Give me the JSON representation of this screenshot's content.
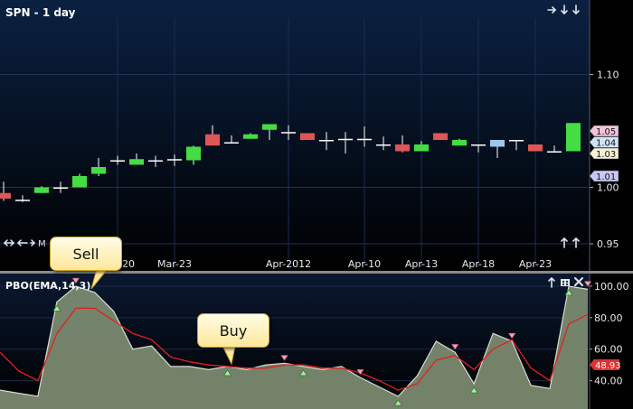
{
  "top_panel": {
    "title": "SPN - 1 day",
    "toolbar_label": "M",
    "nav_icons": [
      "arrow-right-icon",
      "arrow-down-icon",
      "arrow-down-icon"
    ],
    "price_markers": [
      {
        "label": "1.05",
        "value": 1.05,
        "color": "#f2c4dc"
      },
      {
        "label": "1.04",
        "value": 1.04,
        "color": "#cfe3f5"
      },
      {
        "label": "1.03",
        "value": 1.03,
        "color": "#f7f0d8"
      },
      {
        "label": "1.01",
        "value": 1.01,
        "color": "#c8c8f4"
      }
    ]
  },
  "bottom_panel": {
    "title": "PBO(EMA,14,3)",
    "current_value_label": "48.93",
    "current_value": 48.93
  },
  "callouts": {
    "sell": "Sell",
    "buy": "Buy"
  },
  "colors": {
    "up": "#44dd44",
    "down": "#e05555",
    "neutral": "#ffffff",
    "highlight": "#9cc8f0",
    "area": "#7e8d72",
    "signal": "#e02020",
    "background_top": "#0b2142",
    "background_bottom": "#000000"
  },
  "chart_data": [
    {
      "type": "candlestick",
      "title": "SPN - 1 day",
      "y_ticks": [
        0.95,
        1.0,
        1.1
      ],
      "ylim": [
        0.93,
        1.15
      ],
      "x_tick_labels": [
        {
          "label": "Mar-20",
          "index": 6
        },
        {
          "label": "Mar-23",
          "index": 9
        },
        {
          "label": "Apr-2012",
          "index": 15
        },
        {
          "label": "Apr-10",
          "index": 19
        },
        {
          "label": "Apr-13",
          "index": 22
        },
        {
          "label": "Apr-18",
          "index": 25
        },
        {
          "label": "Apr-23",
          "index": 28
        }
      ],
      "candles": [
        {
          "o": 0.995,
          "h": 1.005,
          "l": 0.988,
          "c": 0.99,
          "color": "down"
        },
        {
          "o": 0.989,
          "h": 0.993,
          "l": 0.987,
          "c": 0.989,
          "color": "neutral"
        },
        {
          "o": 0.995,
          "h": 1.001,
          "l": 0.995,
          "c": 1.0,
          "color": "up"
        },
        {
          "o": 1.0,
          "h": 1.005,
          "l": 0.995,
          "c": 1.0,
          "color": "neutral"
        },
        {
          "o": 1.0,
          "h": 1.012,
          "l": 1.0,
          "c": 1.01,
          "color": "up"
        },
        {
          "o": 1.012,
          "h": 1.026,
          "l": 1.01,
          "c": 1.018,
          "color": "up"
        },
        {
          "o": 1.024,
          "h": 1.028,
          "l": 1.02,
          "c": 1.024,
          "color": "neutral"
        },
        {
          "o": 1.02,
          "h": 1.03,
          "l": 1.02,
          "c": 1.025,
          "color": "up"
        },
        {
          "o": 1.024,
          "h": 1.028,
          "l": 1.018,
          "c": 1.024,
          "color": "neutral"
        },
        {
          "o": 1.025,
          "h": 1.029,
          "l": 1.019,
          "c": 1.025,
          "color": "neutral"
        },
        {
          "o": 1.024,
          "h": 1.037,
          "l": 1.02,
          "c": 1.036,
          "color": "up"
        },
        {
          "o": 1.047,
          "h": 1.055,
          "l": 1.039,
          "c": 1.037,
          "color": "down"
        },
        {
          "o": 1.04,
          "h": 1.046,
          "l": 1.04,
          "c": 1.04,
          "color": "neutral"
        },
        {
          "o": 1.043,
          "h": 1.048,
          "l": 1.043,
          "c": 1.047,
          "color": "up"
        },
        {
          "o": 1.051,
          "h": 1.056,
          "l": 1.042,
          "c": 1.056,
          "color": "up"
        },
        {
          "o": 1.049,
          "h": 1.055,
          "l": 1.042,
          "c": 1.049,
          "color": "neutral"
        },
        {
          "o": 1.048,
          "h": 1.048,
          "l": 1.042,
          "c": 1.042,
          "color": "down"
        },
        {
          "o": 1.042,
          "h": 1.049,
          "l": 1.033,
          "c": 1.042,
          "color": "neutral"
        },
        {
          "o": 1.043,
          "h": 1.049,
          "l": 1.03,
          "c": 1.043,
          "color": "neutral"
        },
        {
          "o": 1.043,
          "h": 1.054,
          "l": 1.036,
          "c": 1.043,
          "color": "neutral"
        },
        {
          "o": 1.038,
          "h": 1.045,
          "l": 1.033,
          "c": 1.038,
          "color": "neutral"
        },
        {
          "o": 1.038,
          "h": 1.046,
          "l": 1.031,
          "c": 1.032,
          "color": "down"
        },
        {
          "o": 1.032,
          "h": 1.041,
          "l": 1.032,
          "c": 1.038,
          "color": "up"
        },
        {
          "o": 1.048,
          "h": 1.048,
          "l": 1.042,
          "c": 1.042,
          "color": "down"
        },
        {
          "o": 1.037,
          "h": 1.043,
          "l": 1.037,
          "c": 1.042,
          "color": "up"
        },
        {
          "o": 1.038,
          "h": 1.038,
          "l": 1.031,
          "c": 1.038,
          "color": "neutral"
        },
        {
          "o": 1.036,
          "h": 1.042,
          "l": 1.026,
          "c": 1.042,
          "color": "highlight"
        },
        {
          "o": 1.042,
          "h": 1.042,
          "l": 1.033,
          "c": 1.042,
          "color": "neutral"
        },
        {
          "o": 1.038,
          "h": 1.038,
          "l": 1.032,
          "c": 1.032,
          "color": "down"
        },
        {
          "o": 1.032,
          "h": 1.037,
          "l": 1.032,
          "c": 1.032,
          "color": "neutral"
        },
        {
          "o": 1.032,
          "h": 1.057,
          "l": 1.032,
          "c": 1.057,
          "color": "up"
        }
      ]
    },
    {
      "type": "area",
      "title": "PBO(EMA,14,3)",
      "y_ticks": [
        40.0,
        60.0,
        80.0,
        100.0
      ],
      "ylim": [
        22,
        108
      ],
      "series": [
        {
          "values": [
            34,
            32,
            30,
            90,
            100,
            96,
            84,
            60,
            62,
            49,
            49,
            47,
            49,
            47,
            50,
            51,
            49,
            47,
            49,
            42,
            36,
            30,
            43,
            65,
            58,
            38,
            70,
            65,
            37,
            35,
            100,
            98
          ]
        },
        {
          "values": [
            58,
            46,
            40,
            70,
            86,
            86,
            78,
            70,
            66,
            55,
            52,
            50,
            49,
            48,
            48,
            50,
            50,
            48,
            48,
            45,
            40,
            34,
            38,
            53,
            56,
            47,
            60,
            66,
            48,
            40,
            76,
            82
          ]
        }
      ],
      "buy_markers": [
        3,
        12,
        16,
        21,
        25,
        30
      ],
      "sell_markers": [
        4,
        15,
        19,
        24,
        27,
        31
      ]
    }
  ]
}
